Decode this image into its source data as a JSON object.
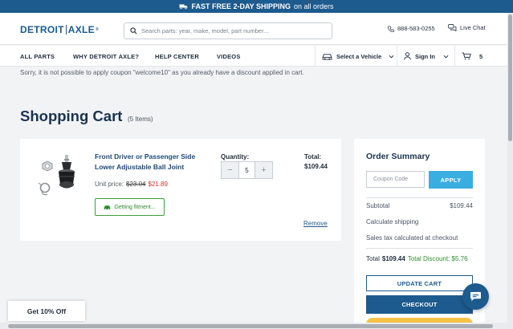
{
  "banner": {
    "bold_text": "FAST FREE 2-DAY SHIPPING",
    "rest_text": "on all orders",
    "icon": "truck-icon"
  },
  "header": {
    "logo_left": "DETROIT",
    "logo_right": "AXLE",
    "logo_mark": "®",
    "search_placeholder": "Search parts: year, make, model, part number...",
    "phone": "888-583-0255",
    "chat_label": "Live Chat"
  },
  "nav": {
    "items": [
      "ALL PARTS",
      "WHY DETROIT AXLE?",
      "HELP CENTER",
      "VIDEOS"
    ],
    "select_vehicle": "Select a Vehicle",
    "sign_in": "Sign In",
    "cart_count": "5"
  },
  "notice": "Sorry, it is not possible to apply coupon \"welcome10\" as you already have a discount applied in cart.",
  "cart": {
    "title": "Shopping Cart",
    "count_label": "(5 Items)",
    "item": {
      "name": "Front Driver or Passenger Side Lower Adjustable Ball Joint",
      "unit_price_label": "Unit price:",
      "old_price": "$23.04",
      "new_price": "$21.89",
      "fitment_label": "Getting fitment...",
      "quantity_label": "Quantity:",
      "quantity": "5",
      "minus": "−",
      "plus": "+",
      "total_label": "Total:",
      "total_value": "$109.44",
      "remove_label": "Remove"
    }
  },
  "summary": {
    "title": "Order Summary",
    "coupon_placeholder": "Coupon Code",
    "apply_label": "APPLY",
    "subtotal_label": "Subtotal",
    "subtotal_value": "$109.44",
    "shipping_label": "Calculate shipping",
    "tax_label": "Sales tax calculated at checkout",
    "total_label": "Total",
    "total_value": "$109.44",
    "discount_label": "Total Discount: $5.76",
    "update_label": "UPDATE CART",
    "checkout_label": "CHECKOUT"
  },
  "promo": {
    "label": "Get 10% Off"
  },
  "colors": {
    "brand": "#1d5a8e",
    "accent": "#3aaee0",
    "sale": "#d0312d",
    "discount": "#2e8b2e"
  }
}
